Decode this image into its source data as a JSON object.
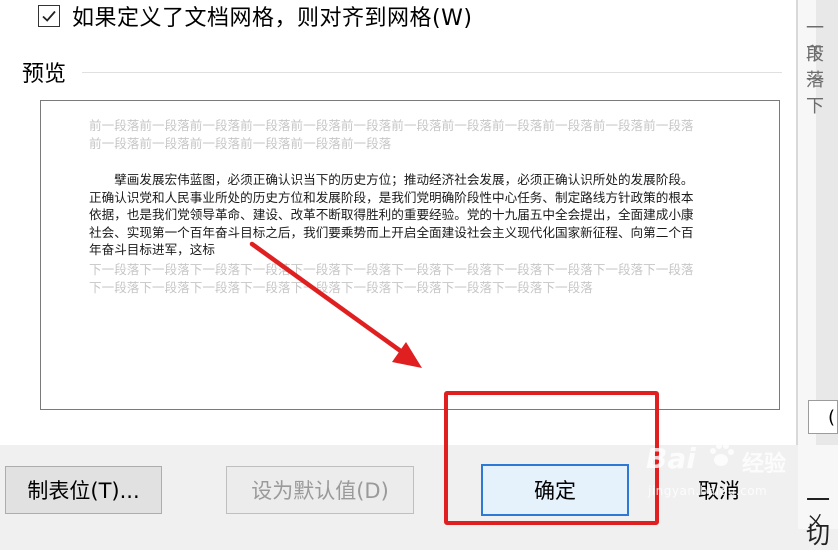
{
  "checkbox": {
    "checked": true,
    "label": "如果定义了文档网格，则对齐到网格(W)"
  },
  "preview": {
    "label": "预览",
    "previous_paragraph": "前一段落前一段落前一段落前一段落前一段落前一段落前一段落前一段落前一段落前一段落前一段落前一段落前一段落前一段落前一段落前一段落前一段落前一段落",
    "current_paragraph": "擘画发展宏伟蓝图，必须正确认识当下的历史方位；推动经济社会发展，必须正确认识所处的发展阶段。正确认识党和人民事业所处的历史方位和发展阶段，是我们党明确阶段性中心任务、制定路线方针政策的根本依据，也是我们党领导革命、建设、改革不断取得胜利的重要经验。党的十九届五中全会提出，全面建成小康社会、实现第一个百年奋斗目标之后，我们要乘势而上开启全面建设社会主义现代化国家新征程、向第二个百年奋斗目标进军，这标",
    "next_paragraph": "下一段落下一段落下一段落下一段落下一段落下一段落下一段落下一段落下一段落下一段落下一段落下一段落下一段落下一段落下一段落下一段落下一段落下一段落下一段落下一段落下一段落下一段落"
  },
  "buttons": {
    "tabs": "制表位(T)...",
    "set_default": "设为默认值(D)",
    "ok": "确定",
    "cancel": "取消"
  },
  "background_document": {
    "line1": "一段",
    "line2": "下一",
    "line3": "落下",
    "input_char": "(",
    "char_bottom": "一切",
    "char_bottom2": "ㄨ"
  },
  "watermark": {
    "brand": "Bai",
    "suffix": "经验",
    "url": "jingyan.baidu.com"
  },
  "colors": {
    "annotation": "#e02020",
    "ok_border": "#2e78d6"
  }
}
